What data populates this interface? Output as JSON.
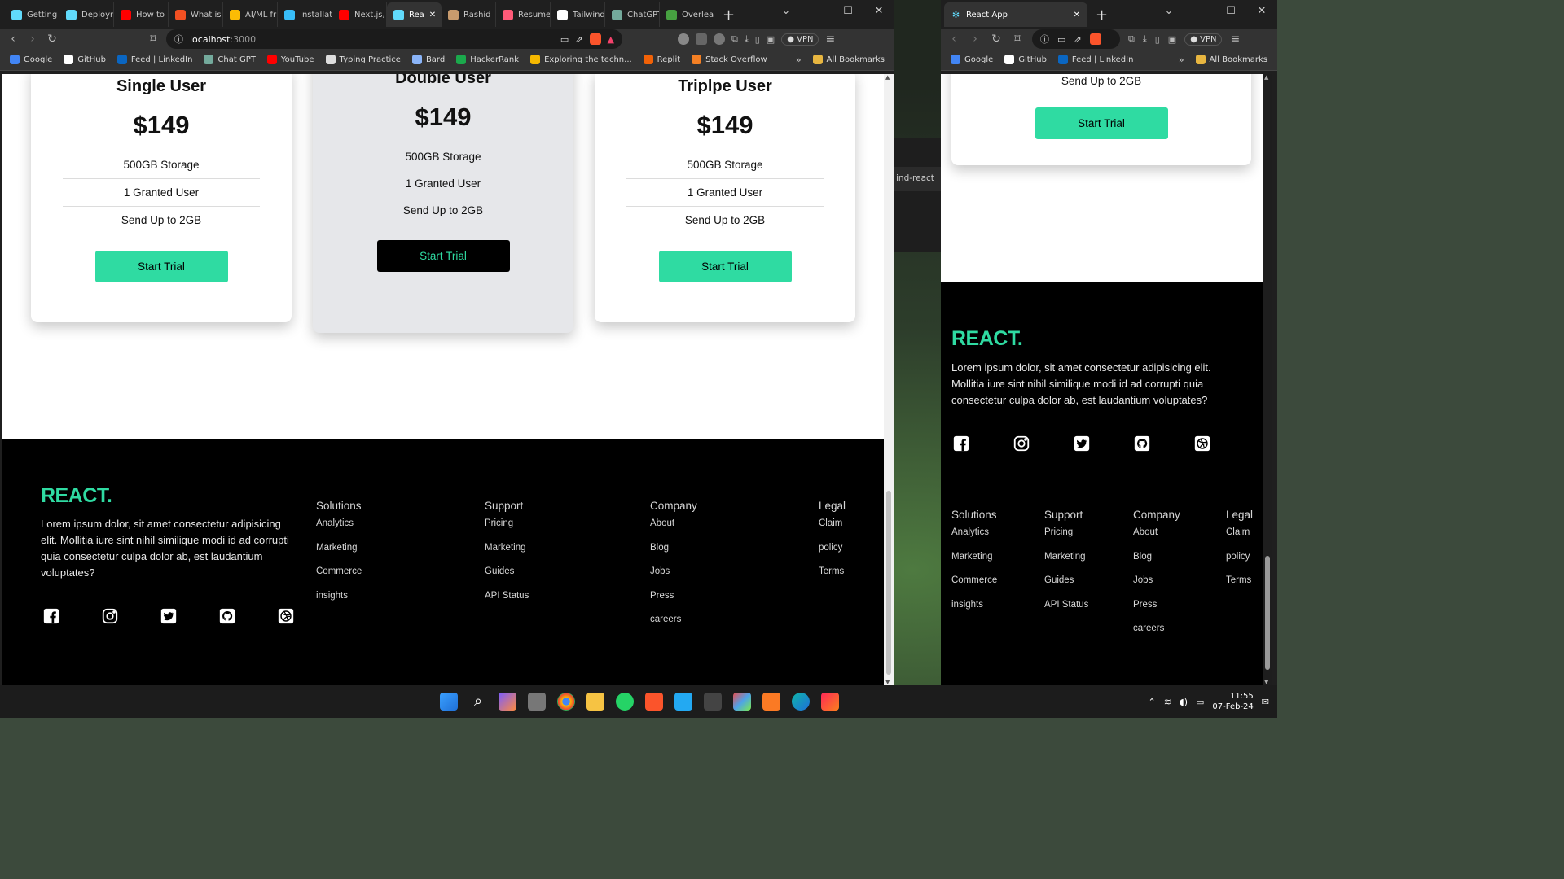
{
  "browser_left": {
    "tabs": [
      {
        "label": "Getting",
        "icon": "react-icon",
        "color": "#61dafb"
      },
      {
        "label": "Deploym",
        "icon": "react-icon",
        "color": "#61dafb"
      },
      {
        "label": "How to",
        "icon": "youtube-icon",
        "color": "#ff0000"
      },
      {
        "label": "What is",
        "icon": "microsoft-icon",
        "color": "#f25022"
      },
      {
        "label": "AI/ML fr",
        "icon": "google-drive-icon",
        "color": "#fbbc04"
      },
      {
        "label": "Installat",
        "icon": "tailwind-icon",
        "color": "#38bdf8"
      },
      {
        "label": "Next.js,",
        "icon": "youtube-icon",
        "color": "#ff0000"
      },
      {
        "label": "Rea",
        "icon": "react-icon",
        "color": "#61dafb"
      },
      {
        "label": "Rashid",
        "icon": "avatar-icon",
        "color": "#c89b6d"
      },
      {
        "label": "Resume",
        "icon": "diamond-icon",
        "color": "#ff5a78"
      },
      {
        "label": "Tailwind",
        "icon": "github-icon",
        "color": "#ffffff"
      },
      {
        "label": "ChatGPT",
        "icon": "chatgpt-icon",
        "color": "#74aa9c"
      },
      {
        "label": "Overleaf",
        "icon": "overleaf-icon",
        "color": "#47a141"
      }
    ],
    "url_host": "localhost",
    "url_port": ":3000",
    "vpn_label": "VPN",
    "bookmarks": [
      {
        "label": "Google",
        "icon": "google-icon",
        "color": "#4285f4"
      },
      {
        "label": "GitHub",
        "icon": "github-icon",
        "color": "#ffffff"
      },
      {
        "label": "Feed | LinkedIn",
        "icon": "linkedin-icon",
        "color": "#0a66c2"
      },
      {
        "label": "Chat GPT",
        "icon": "chatgpt-icon",
        "color": "#74aa9c"
      },
      {
        "label": "YouTube",
        "icon": "youtube-icon",
        "color": "#ff0000"
      },
      {
        "label": "Typing Practice",
        "icon": "typing-icon",
        "color": "#dddddd"
      },
      {
        "label": "Bard",
        "icon": "bard-icon",
        "color": "#8ab4f8"
      },
      {
        "label": "HackerRank",
        "icon": "hackerrank-icon",
        "color": "#1ba94c"
      },
      {
        "label": "Exploring the techn...",
        "icon": "sh-icon",
        "color": "#f5b800"
      },
      {
        "label": "Replit",
        "icon": "replit-icon",
        "color": "#f26207"
      },
      {
        "label": "Stack Overflow",
        "icon": "stackoverflow-icon",
        "color": "#f48024"
      }
    ],
    "all_bookmarks": "All Bookmarks"
  },
  "browser_right": {
    "tab_label": "React App",
    "vpn_label": "VPN",
    "bookmarks": [
      {
        "label": "Google",
        "icon": "google-icon",
        "color": "#4285f4"
      },
      {
        "label": "GitHub",
        "icon": "github-icon",
        "color": "#ffffff"
      },
      {
        "label": "Feed | LinkedIn",
        "icon": "linkedin-icon",
        "color": "#0a66c2"
      }
    ],
    "all_bookmarks": "All Bookmarks"
  },
  "background_snippet": "ind-react",
  "pricing": {
    "cards": [
      {
        "title": "Single User",
        "price": "$149",
        "features": [
          "500GB Storage",
          "1 Granted User",
          "Send Up to 2GB"
        ],
        "button": "Start Trial"
      },
      {
        "title": "Double User",
        "price": "$149",
        "features": [
          "500GB Storage",
          "1 Granted User",
          "Send Up to 2GB"
        ],
        "button": "Start Trial"
      },
      {
        "title": "Triplpe User",
        "price": "$149",
        "features": [
          "500GB Storage",
          "1 Granted User",
          "Send Up to 2GB"
        ],
        "button": "Start Trial"
      }
    ],
    "mobile_partial": {
      "feature": "Send Up to 2GB",
      "button": "Start Trial"
    }
  },
  "footer": {
    "brand": "REACT.",
    "description": "Lorem ipsum dolor, sit amet consectetur adipisicing elit. Mollitia iure sint nihil similique modi id ad corrupti quia consectetur culpa dolor ab, est laudantium voluptates?",
    "social": [
      "facebook-icon",
      "instagram-icon",
      "twitter-icon",
      "github-icon",
      "dribbble-icon"
    ],
    "columns": [
      {
        "heading": "Solutions",
        "items": [
          "Analytics",
          "Marketing",
          "Commerce",
          "insights"
        ]
      },
      {
        "heading": "Support",
        "items": [
          "Pricing",
          "Marketing",
          "Guides",
          "API Status"
        ]
      },
      {
        "heading": "Company",
        "items": [
          "About",
          "Blog",
          "Jobs",
          "Press",
          "careers"
        ]
      },
      {
        "heading": "Legal",
        "items": [
          "Claim",
          "policy",
          "Terms"
        ]
      }
    ]
  },
  "taskbar": {
    "time": "11:55",
    "date": "07-Feb-24"
  },
  "colors": {
    "accent": "#2fdba2",
    "footer_bg": "#000000",
    "button_dark": "#000000"
  }
}
